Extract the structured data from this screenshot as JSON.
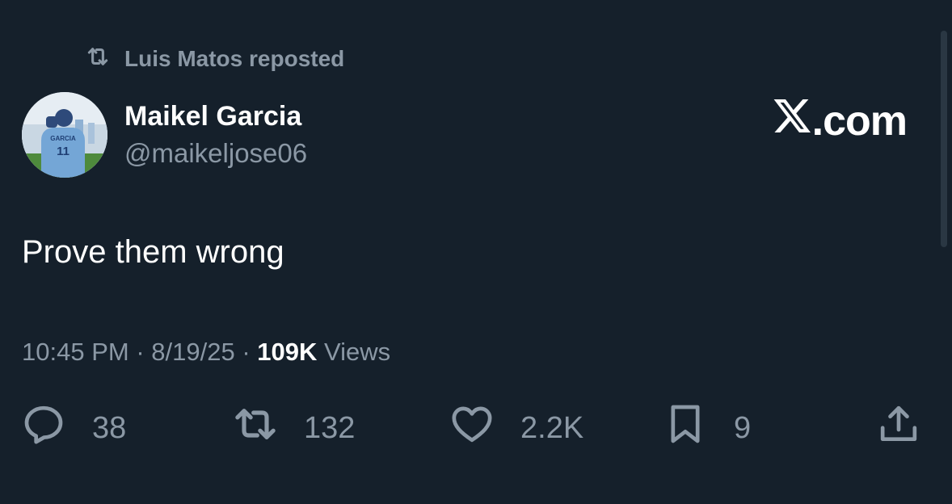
{
  "repost": {
    "label": "Luis Matos reposted",
    "icon": "retweet-icon"
  },
  "author": {
    "name": "Maikel Garcia",
    "handle": "@maikeljose06",
    "avatar_jersey_name": "GARCIA",
    "avatar_jersey_number": "11"
  },
  "brand": {
    "label": ".com",
    "icon": "x-logo-icon"
  },
  "tweet": {
    "text": "Prove them wrong",
    "time": "10:45 PM",
    "separator": "·",
    "date": "8/19/25",
    "views_count": "109K",
    "views_label": "Views"
  },
  "actions": {
    "reply_count": "38",
    "repost_count": "132",
    "like_count": "2.2K",
    "bookmark_count": "9"
  },
  "colors": {
    "background": "#15202b",
    "secondary_text": "#8b98a5",
    "primary_text": "#ffffff",
    "jersey_blue": "#74a6d6"
  }
}
